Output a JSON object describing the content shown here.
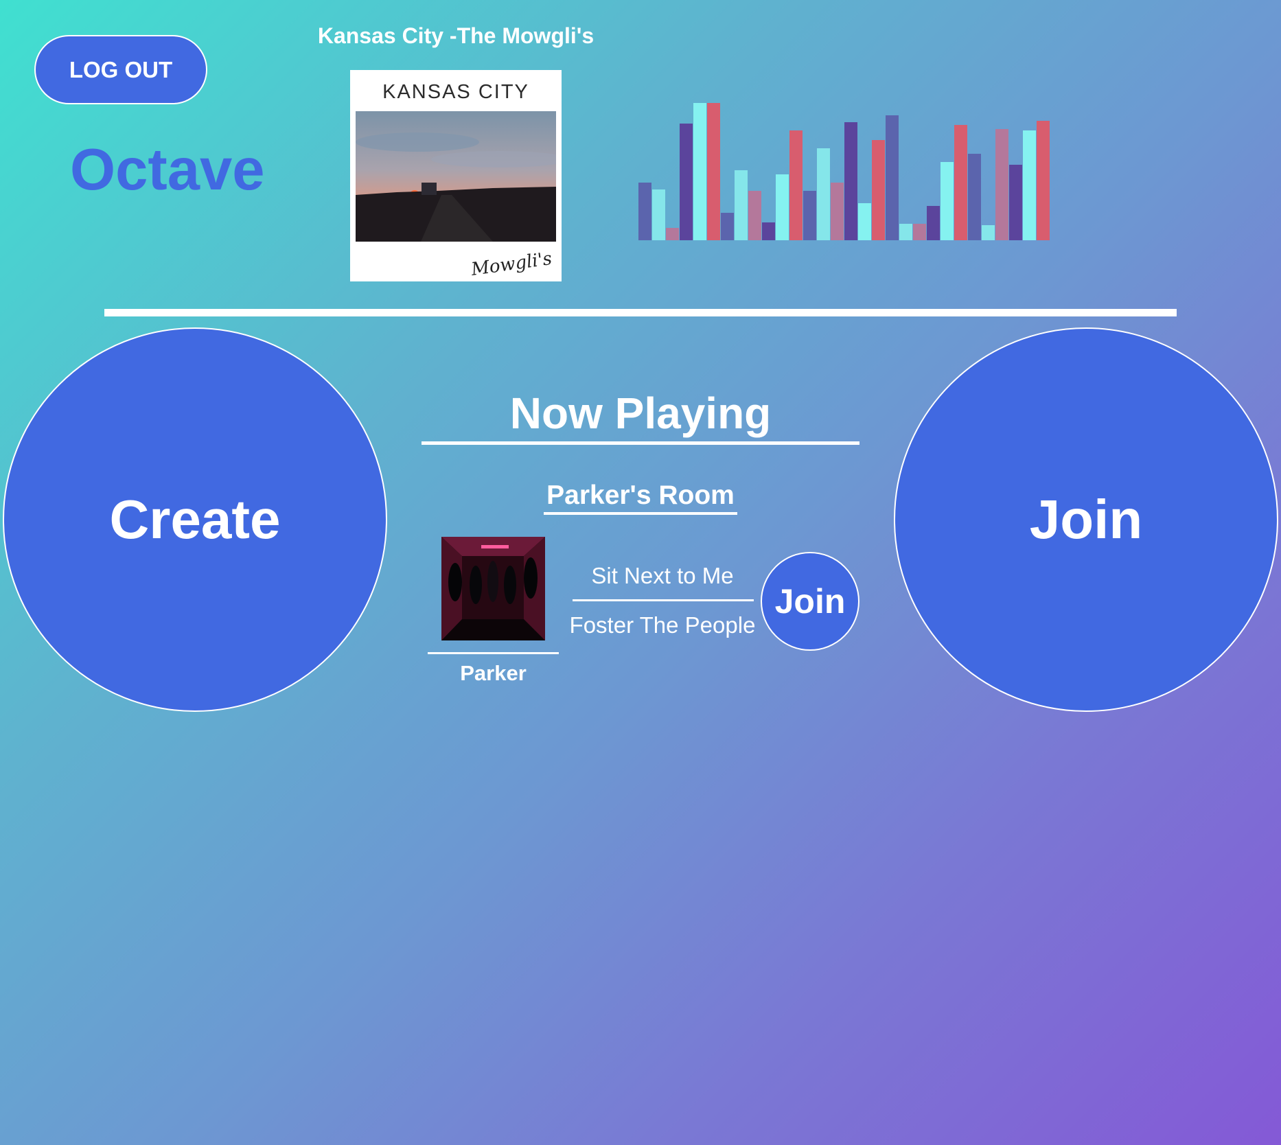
{
  "header": {
    "logout_label": "LOG OUT",
    "brand": "Octave",
    "now_track": "Kansas City -The Mowgli's",
    "cover_text": "KANSAS CITY",
    "cover_signature": "Mowgli's"
  },
  "visualizer": {
    "levels": [
      0.42,
      0.37,
      0.09,
      0.85,
      1.0,
      1.0,
      0.2,
      0.51,
      0.36,
      0.13,
      0.48,
      0.8,
      0.36,
      0.67,
      0.42,
      0.86,
      0.27,
      0.73,
      0.91,
      0.12,
      0.12,
      0.25,
      0.57,
      0.84,
      0.63,
      0.11,
      0.81,
      0.55,
      0.8,
      0.87
    ],
    "colors": [
      "#5b64ad",
      "#85e6ea",
      "#b4789b",
      "#5b449c",
      "#85f2f0",
      "#d85d6e"
    ]
  },
  "actions": {
    "create_label": "Create",
    "join_label": "Join"
  },
  "now_playing": {
    "heading": "Now Playing",
    "room_name": "Parker's Room",
    "song": "Sit Next to Me",
    "artist": "Foster The People",
    "host": "Parker",
    "join_label": "Join"
  }
}
